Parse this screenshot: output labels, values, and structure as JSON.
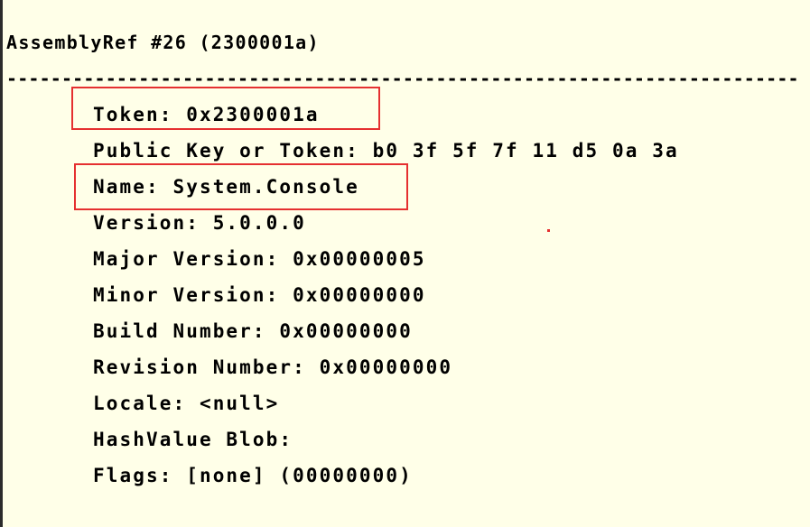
{
  "header": {
    "title": "AssemblyRef #26 (2300001a)",
    "separator": "------------------------------------------------------------------------------------------------------------"
  },
  "fields": [
    "Token: 0x2300001a",
    "Public Key or Token: b0 3f 5f 7f 11 d5 0a 3a",
    "Name: System.Console",
    "Version: 5.0.0.0",
    "Major Version: 0x00000005",
    "Minor Version: 0x00000000",
    "Build Number: 0x00000000",
    "Revision Number: 0x00000000",
    "Locale: <null>",
    "HashValue Blob:",
    "Flags: [none] (00000000)"
  ],
  "colors": {
    "background": "#ffffe8",
    "highlight": "#e53030",
    "text": "#000000"
  }
}
